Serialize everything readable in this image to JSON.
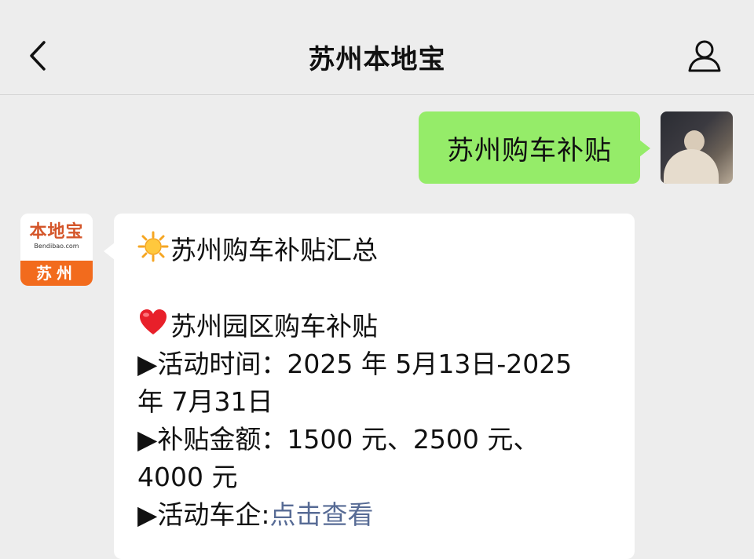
{
  "header": {
    "title": "苏州本地宝"
  },
  "outgoing": {
    "text": "苏州购车补贴"
  },
  "bot_avatar": {
    "logo_cn": "本地宝",
    "logo_en": "Bendibao.com",
    "city": "苏州"
  },
  "incoming": {
    "summary_title": "苏州购车补贴汇总",
    "section_title": "苏州园区购车补贴",
    "time_label": "▶活动时间：",
    "time_value_1": "2025 年 5月13日-2025",
    "time_value_2": "年 7月31日",
    "amount_label": "▶补贴金额：",
    "amount_value_1": "1500 元、2500 元、",
    "amount_value_2": "4000 元",
    "enterprise_label": "▶活动车企:",
    "enterprise_link": "点击查看"
  },
  "colors": {
    "outgoing_bubble": "#95ec69",
    "link": "#576b95",
    "brand_orange": "#f26b1d"
  },
  "icons": {
    "back": "chevron-left-icon",
    "profile": "person-icon",
    "sun": "sun-emoji",
    "heart": "heart-emoji"
  }
}
